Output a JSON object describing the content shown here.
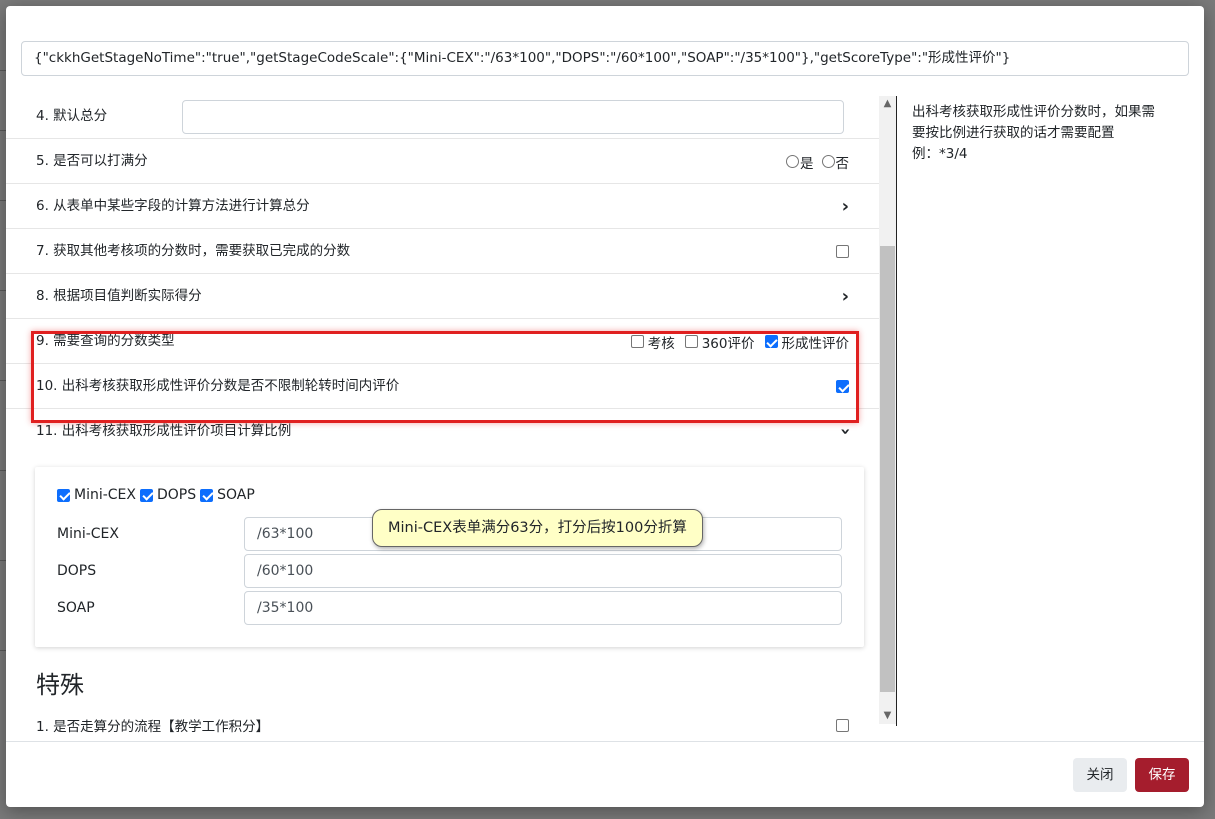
{
  "json_config": "{\"ckkhGetStageNoTime\":\"true\",\"getStageCodeScale\":{\"Mini-CEX\":\"/63*100\",\"DOPS\":\"/60*100\",\"SOAP\":\"/35*100\"},\"getScoreType\":\"形成性评价\"}",
  "help": {
    "line1": "出科考核获取形成性评价分数时，如果需",
    "line2": "要按比例进行获取的话才需要配置",
    "line3": "例：*3/4"
  },
  "rows": {
    "r4": {
      "label": "4. 默认总分"
    },
    "r5": {
      "label": "5. 是否可以打满分",
      "opt_yes": "是",
      "opt_no": "否"
    },
    "r6": {
      "label": "6. 从表单中某些字段的计算方法进行计算总分"
    },
    "r7": {
      "label": "7. 获取其他考核项的分数时，需要获取已完成的分数"
    },
    "r8": {
      "label": "8. 根据项目值判断实际得分"
    },
    "r9": {
      "label": "9. 需要查询的分数类型",
      "opt1": "考核",
      "opt2": "360评价",
      "opt3": "形成性评价"
    },
    "r10": {
      "label": "10. 出科考核获取形成性评价分数是否不限制轮转时间内评价"
    },
    "r11": {
      "label": "11. 出科考核获取形成性评价项目计算比例"
    }
  },
  "scale_card": {
    "check_minicex": "Mini-CEX",
    "check_dops": "DOPS",
    "check_soap": "SOAP",
    "fields": [
      {
        "label": "Mini-CEX",
        "value": "/63*100"
      },
      {
        "label": "DOPS",
        "value": "/60*100"
      },
      {
        "label": "SOAP",
        "value": "/35*100"
      }
    ]
  },
  "tooltip": "Mini-CEX表单满分63分，打分后按100分折算",
  "special": {
    "title": "特殊",
    "row1_label": "1. 是否走算分的流程【教学工作积分】"
  },
  "footer": {
    "close": "关闭",
    "save": "保存"
  },
  "icons": {
    "chevron_right": "chevron-right-icon",
    "chevron_down": "chevron-down-icon"
  },
  "colors": {
    "primary": "#0d6efd",
    "save": "#a51d2d",
    "highlight": "#e02020",
    "tooltip_bg": "#ffffc6"
  }
}
